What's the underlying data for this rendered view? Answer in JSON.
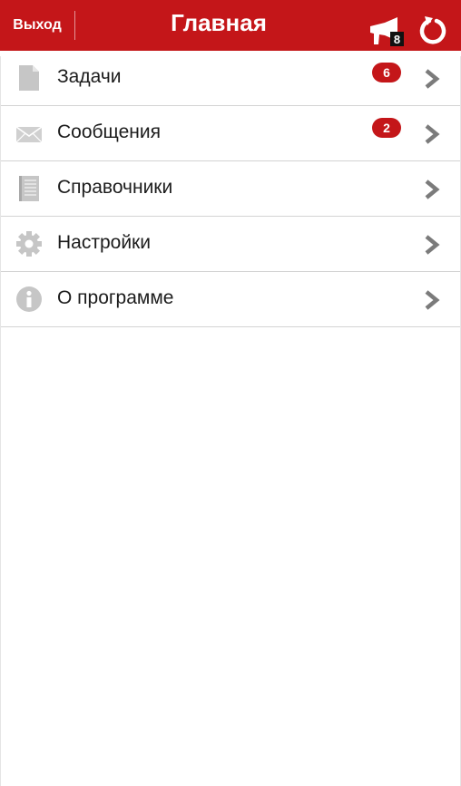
{
  "header": {
    "exit_label": "Выход",
    "title": "Главная",
    "notification_count": "8",
    "accent_color": "#c41619"
  },
  "menu": {
    "items": [
      {
        "label": "Задачи",
        "icon": "document-icon",
        "badge": "6"
      },
      {
        "label": "Сообщения",
        "icon": "envelope-icon",
        "badge": "2"
      },
      {
        "label": "Справочники",
        "icon": "notebook-icon",
        "badge": ""
      },
      {
        "label": "Настройки",
        "icon": "gear-icon",
        "badge": ""
      },
      {
        "label": "О программе",
        "icon": "info-icon",
        "badge": ""
      }
    ]
  }
}
